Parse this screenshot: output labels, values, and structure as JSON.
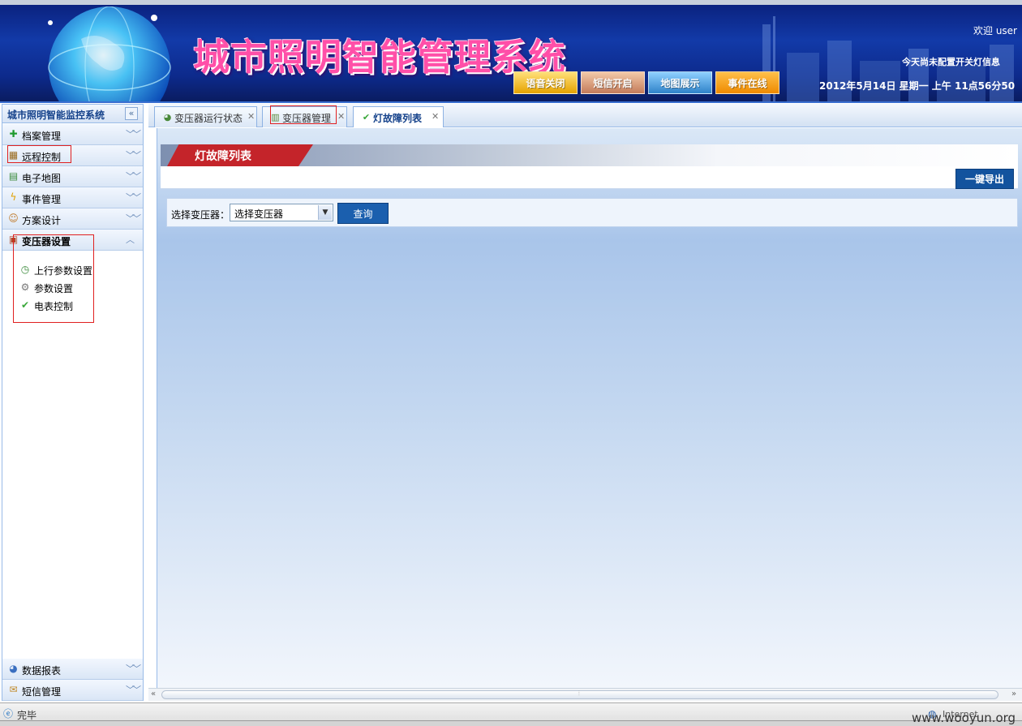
{
  "header": {
    "system_title": "城市照明智能管理系统",
    "welcome": "欢迎 user",
    "today_info": "今天尚未配置开关灯信息",
    "datetime": "2012年5月14日 星期一 上午 11点56分50",
    "buttons": {
      "voice": "语音关闭",
      "sms": "短信开启",
      "map": "地图展示",
      "event": "事件在线"
    }
  },
  "sidebar": {
    "title": "城市照明智能监控系统",
    "collapse_icon": "«",
    "sections": [
      {
        "label": "档案管理",
        "icon": "plus-icon"
      },
      {
        "label": "远程控制",
        "icon": "remote-control-icon"
      },
      {
        "label": "电子地图",
        "icon": "map-icon"
      },
      {
        "label": "事件管理",
        "icon": "lightning-icon"
      },
      {
        "label": "方案设计",
        "icon": "user-icon"
      },
      {
        "label": "变压器设置",
        "icon": "transformer-icon"
      },
      {
        "label": "数据报表",
        "icon": "report-icon"
      },
      {
        "label": "短信管理",
        "icon": "mail-icon"
      }
    ],
    "sub_items": [
      {
        "label": "上行参数设置",
        "icon": "clock-icon"
      },
      {
        "label": "参数设置",
        "icon": "gear-icon"
      },
      {
        "label": "电表控制",
        "icon": "check-icon"
      }
    ]
  },
  "tabs": [
    {
      "label": "变压器运行状态",
      "icon": "status-icon"
    },
    {
      "label": "变压器管理",
      "icon": "grid-icon"
    },
    {
      "label": "灯故障列表",
      "icon": "check-icon"
    }
  ],
  "panel": {
    "title": "灯故障列表",
    "export_label": "一键导出",
    "filter_label": "选择变压器：",
    "select_value": "选择变压器",
    "query_label": "查询"
  },
  "statusbar": {
    "status_text": "完毕",
    "zone": "Internet"
  },
  "watermark": "www.wooyun.org",
  "colors": {
    "header_bg": "#123aa8",
    "title_pink": "#ff4fa8",
    "panel_red": "#c4242a",
    "button_blue": "#13539e",
    "annotation_red": "#e02020"
  }
}
